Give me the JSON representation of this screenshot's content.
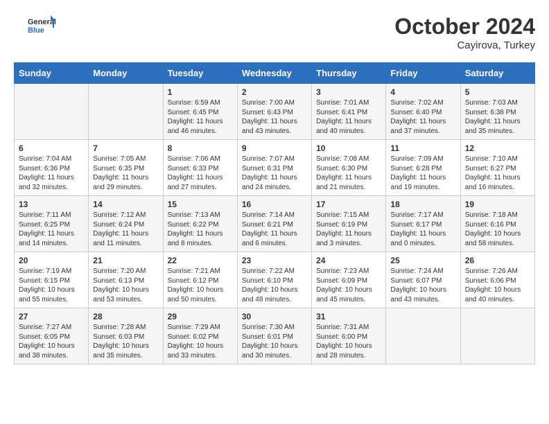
{
  "logo": {
    "line1": "General",
    "line2": "Blue"
  },
  "title": "October 2024",
  "subtitle": "Cayirova, Turkey",
  "header_days": [
    "Sunday",
    "Monday",
    "Tuesday",
    "Wednesday",
    "Thursday",
    "Friday",
    "Saturday"
  ],
  "weeks": [
    [
      {
        "day": "",
        "sunrise": "",
        "sunset": "",
        "daylight": ""
      },
      {
        "day": "",
        "sunrise": "",
        "sunset": "",
        "daylight": ""
      },
      {
        "day": "1",
        "sunrise": "Sunrise: 6:59 AM",
        "sunset": "Sunset: 6:45 PM",
        "daylight": "Daylight: 11 hours and 46 minutes."
      },
      {
        "day": "2",
        "sunrise": "Sunrise: 7:00 AM",
        "sunset": "Sunset: 6:43 PM",
        "daylight": "Daylight: 11 hours and 43 minutes."
      },
      {
        "day": "3",
        "sunrise": "Sunrise: 7:01 AM",
        "sunset": "Sunset: 6:41 PM",
        "daylight": "Daylight: 11 hours and 40 minutes."
      },
      {
        "day": "4",
        "sunrise": "Sunrise: 7:02 AM",
        "sunset": "Sunset: 6:40 PM",
        "daylight": "Daylight: 11 hours and 37 minutes."
      },
      {
        "day": "5",
        "sunrise": "Sunrise: 7:03 AM",
        "sunset": "Sunset: 6:38 PM",
        "daylight": "Daylight: 11 hours and 35 minutes."
      }
    ],
    [
      {
        "day": "6",
        "sunrise": "Sunrise: 7:04 AM",
        "sunset": "Sunset: 6:36 PM",
        "daylight": "Daylight: 11 hours and 32 minutes."
      },
      {
        "day": "7",
        "sunrise": "Sunrise: 7:05 AM",
        "sunset": "Sunset: 6:35 PM",
        "daylight": "Daylight: 11 hours and 29 minutes."
      },
      {
        "day": "8",
        "sunrise": "Sunrise: 7:06 AM",
        "sunset": "Sunset: 6:33 PM",
        "daylight": "Daylight: 11 hours and 27 minutes."
      },
      {
        "day": "9",
        "sunrise": "Sunrise: 7:07 AM",
        "sunset": "Sunset: 6:31 PM",
        "daylight": "Daylight: 11 hours and 24 minutes."
      },
      {
        "day": "10",
        "sunrise": "Sunrise: 7:08 AM",
        "sunset": "Sunset: 6:30 PM",
        "daylight": "Daylight: 11 hours and 21 minutes."
      },
      {
        "day": "11",
        "sunrise": "Sunrise: 7:09 AM",
        "sunset": "Sunset: 6:28 PM",
        "daylight": "Daylight: 11 hours and 19 minutes."
      },
      {
        "day": "12",
        "sunrise": "Sunrise: 7:10 AM",
        "sunset": "Sunset: 6:27 PM",
        "daylight": "Daylight: 11 hours and 16 minutes."
      }
    ],
    [
      {
        "day": "13",
        "sunrise": "Sunrise: 7:11 AM",
        "sunset": "Sunset: 6:25 PM",
        "daylight": "Daylight: 11 hours and 14 minutes."
      },
      {
        "day": "14",
        "sunrise": "Sunrise: 7:12 AM",
        "sunset": "Sunset: 6:24 PM",
        "daylight": "Daylight: 11 hours and 11 minutes."
      },
      {
        "day": "15",
        "sunrise": "Sunrise: 7:13 AM",
        "sunset": "Sunset: 6:22 PM",
        "daylight": "Daylight: 11 hours and 8 minutes."
      },
      {
        "day": "16",
        "sunrise": "Sunrise: 7:14 AM",
        "sunset": "Sunset: 6:21 PM",
        "daylight": "Daylight: 11 hours and 6 minutes."
      },
      {
        "day": "17",
        "sunrise": "Sunrise: 7:15 AM",
        "sunset": "Sunset: 6:19 PM",
        "daylight": "Daylight: 11 hours and 3 minutes."
      },
      {
        "day": "18",
        "sunrise": "Sunrise: 7:17 AM",
        "sunset": "Sunset: 6:17 PM",
        "daylight": "Daylight: 11 hours and 0 minutes."
      },
      {
        "day": "19",
        "sunrise": "Sunrise: 7:18 AM",
        "sunset": "Sunset: 6:16 PM",
        "daylight": "Daylight: 10 hours and 58 minutes."
      }
    ],
    [
      {
        "day": "20",
        "sunrise": "Sunrise: 7:19 AM",
        "sunset": "Sunset: 6:15 PM",
        "daylight": "Daylight: 10 hours and 55 minutes."
      },
      {
        "day": "21",
        "sunrise": "Sunrise: 7:20 AM",
        "sunset": "Sunset: 6:13 PM",
        "daylight": "Daylight: 10 hours and 53 minutes."
      },
      {
        "day": "22",
        "sunrise": "Sunrise: 7:21 AM",
        "sunset": "Sunset: 6:12 PM",
        "daylight": "Daylight: 10 hours and 50 minutes."
      },
      {
        "day": "23",
        "sunrise": "Sunrise: 7:22 AM",
        "sunset": "Sunset: 6:10 PM",
        "daylight": "Daylight: 10 hours and 48 minutes."
      },
      {
        "day": "24",
        "sunrise": "Sunrise: 7:23 AM",
        "sunset": "Sunset: 6:09 PM",
        "daylight": "Daylight: 10 hours and 45 minutes."
      },
      {
        "day": "25",
        "sunrise": "Sunrise: 7:24 AM",
        "sunset": "Sunset: 6:07 PM",
        "daylight": "Daylight: 10 hours and 43 minutes."
      },
      {
        "day": "26",
        "sunrise": "Sunrise: 7:26 AM",
        "sunset": "Sunset: 6:06 PM",
        "daylight": "Daylight: 10 hours and 40 minutes."
      }
    ],
    [
      {
        "day": "27",
        "sunrise": "Sunrise: 7:27 AM",
        "sunset": "Sunset: 6:05 PM",
        "daylight": "Daylight: 10 hours and 38 minutes."
      },
      {
        "day": "28",
        "sunrise": "Sunrise: 7:28 AM",
        "sunset": "Sunset: 6:03 PM",
        "daylight": "Daylight: 10 hours and 35 minutes."
      },
      {
        "day": "29",
        "sunrise": "Sunrise: 7:29 AM",
        "sunset": "Sunset: 6:02 PM",
        "daylight": "Daylight: 10 hours and 33 minutes."
      },
      {
        "day": "30",
        "sunrise": "Sunrise: 7:30 AM",
        "sunset": "Sunset: 6:01 PM",
        "daylight": "Daylight: 10 hours and 30 minutes."
      },
      {
        "day": "31",
        "sunrise": "Sunrise: 7:31 AM",
        "sunset": "Sunset: 6:00 PM",
        "daylight": "Daylight: 10 hours and 28 minutes."
      },
      {
        "day": "",
        "sunrise": "",
        "sunset": "",
        "daylight": ""
      },
      {
        "day": "",
        "sunrise": "",
        "sunset": "",
        "daylight": ""
      }
    ]
  ]
}
